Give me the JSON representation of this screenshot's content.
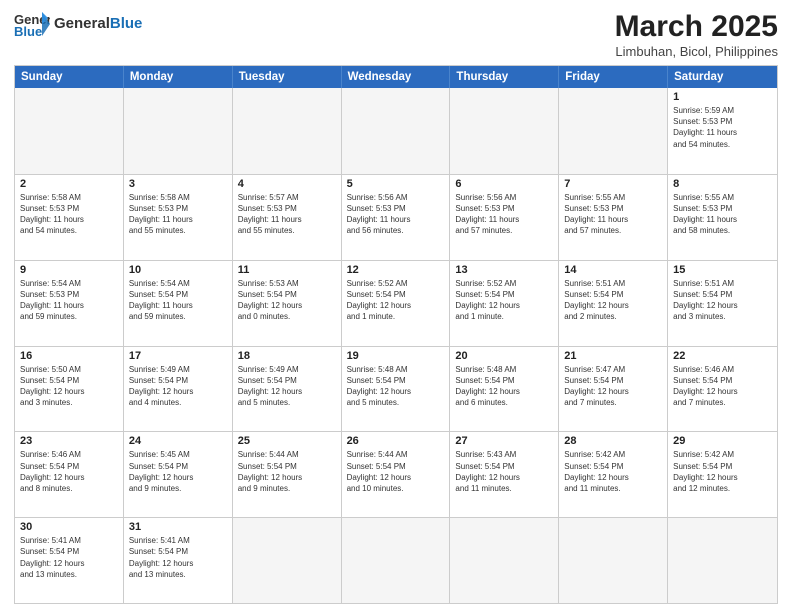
{
  "header": {
    "logo_general": "General",
    "logo_blue": "Blue",
    "title": "March 2025",
    "subtitle": "Limbuhan, Bicol, Philippines"
  },
  "weekdays": [
    "Sunday",
    "Monday",
    "Tuesday",
    "Wednesday",
    "Thursday",
    "Friday",
    "Saturday"
  ],
  "weeks": [
    [
      {
        "day": "",
        "info": ""
      },
      {
        "day": "",
        "info": ""
      },
      {
        "day": "",
        "info": ""
      },
      {
        "day": "",
        "info": ""
      },
      {
        "day": "",
        "info": ""
      },
      {
        "day": "",
        "info": ""
      },
      {
        "day": "1",
        "info": "Sunrise: 5:59 AM\nSunset: 5:53 PM\nDaylight: 11 hours\nand 54 minutes."
      }
    ],
    [
      {
        "day": "2",
        "info": "Sunrise: 5:58 AM\nSunset: 5:53 PM\nDaylight: 11 hours\nand 54 minutes."
      },
      {
        "day": "3",
        "info": "Sunrise: 5:58 AM\nSunset: 5:53 PM\nDaylight: 11 hours\nand 55 minutes."
      },
      {
        "day": "4",
        "info": "Sunrise: 5:57 AM\nSunset: 5:53 PM\nDaylight: 11 hours\nand 55 minutes."
      },
      {
        "day": "5",
        "info": "Sunrise: 5:56 AM\nSunset: 5:53 PM\nDaylight: 11 hours\nand 56 minutes."
      },
      {
        "day": "6",
        "info": "Sunrise: 5:56 AM\nSunset: 5:53 PM\nDaylight: 11 hours\nand 57 minutes."
      },
      {
        "day": "7",
        "info": "Sunrise: 5:55 AM\nSunset: 5:53 PM\nDaylight: 11 hours\nand 57 minutes."
      },
      {
        "day": "8",
        "info": "Sunrise: 5:55 AM\nSunset: 5:53 PM\nDaylight: 11 hours\nand 58 minutes."
      }
    ],
    [
      {
        "day": "9",
        "info": "Sunrise: 5:54 AM\nSunset: 5:53 PM\nDaylight: 11 hours\nand 59 minutes."
      },
      {
        "day": "10",
        "info": "Sunrise: 5:54 AM\nSunset: 5:54 PM\nDaylight: 11 hours\nand 59 minutes."
      },
      {
        "day": "11",
        "info": "Sunrise: 5:53 AM\nSunset: 5:54 PM\nDaylight: 12 hours\nand 0 minutes."
      },
      {
        "day": "12",
        "info": "Sunrise: 5:52 AM\nSunset: 5:54 PM\nDaylight: 12 hours\nand 1 minute."
      },
      {
        "day": "13",
        "info": "Sunrise: 5:52 AM\nSunset: 5:54 PM\nDaylight: 12 hours\nand 1 minute."
      },
      {
        "day": "14",
        "info": "Sunrise: 5:51 AM\nSunset: 5:54 PM\nDaylight: 12 hours\nand 2 minutes."
      },
      {
        "day": "15",
        "info": "Sunrise: 5:51 AM\nSunset: 5:54 PM\nDaylight: 12 hours\nand 3 minutes."
      }
    ],
    [
      {
        "day": "16",
        "info": "Sunrise: 5:50 AM\nSunset: 5:54 PM\nDaylight: 12 hours\nand 3 minutes."
      },
      {
        "day": "17",
        "info": "Sunrise: 5:49 AM\nSunset: 5:54 PM\nDaylight: 12 hours\nand 4 minutes."
      },
      {
        "day": "18",
        "info": "Sunrise: 5:49 AM\nSunset: 5:54 PM\nDaylight: 12 hours\nand 5 minutes."
      },
      {
        "day": "19",
        "info": "Sunrise: 5:48 AM\nSunset: 5:54 PM\nDaylight: 12 hours\nand 5 minutes."
      },
      {
        "day": "20",
        "info": "Sunrise: 5:48 AM\nSunset: 5:54 PM\nDaylight: 12 hours\nand 6 minutes."
      },
      {
        "day": "21",
        "info": "Sunrise: 5:47 AM\nSunset: 5:54 PM\nDaylight: 12 hours\nand 7 minutes."
      },
      {
        "day": "22",
        "info": "Sunrise: 5:46 AM\nSunset: 5:54 PM\nDaylight: 12 hours\nand 7 minutes."
      }
    ],
    [
      {
        "day": "23",
        "info": "Sunrise: 5:46 AM\nSunset: 5:54 PM\nDaylight: 12 hours\nand 8 minutes."
      },
      {
        "day": "24",
        "info": "Sunrise: 5:45 AM\nSunset: 5:54 PM\nDaylight: 12 hours\nand 9 minutes."
      },
      {
        "day": "25",
        "info": "Sunrise: 5:44 AM\nSunset: 5:54 PM\nDaylight: 12 hours\nand 9 minutes."
      },
      {
        "day": "26",
        "info": "Sunrise: 5:44 AM\nSunset: 5:54 PM\nDaylight: 12 hours\nand 10 minutes."
      },
      {
        "day": "27",
        "info": "Sunrise: 5:43 AM\nSunset: 5:54 PM\nDaylight: 12 hours\nand 11 minutes."
      },
      {
        "day": "28",
        "info": "Sunrise: 5:42 AM\nSunset: 5:54 PM\nDaylight: 12 hours\nand 11 minutes."
      },
      {
        "day": "29",
        "info": "Sunrise: 5:42 AM\nSunset: 5:54 PM\nDaylight: 12 hours\nand 12 minutes."
      }
    ],
    [
      {
        "day": "30",
        "info": "Sunrise: 5:41 AM\nSunset: 5:54 PM\nDaylight: 12 hours\nand 13 minutes."
      },
      {
        "day": "31",
        "info": "Sunrise: 5:41 AM\nSunset: 5:54 PM\nDaylight: 12 hours\nand 13 minutes."
      },
      {
        "day": "",
        "info": ""
      },
      {
        "day": "",
        "info": ""
      },
      {
        "day": "",
        "info": ""
      },
      {
        "day": "",
        "info": ""
      },
      {
        "day": "",
        "info": ""
      }
    ]
  ]
}
